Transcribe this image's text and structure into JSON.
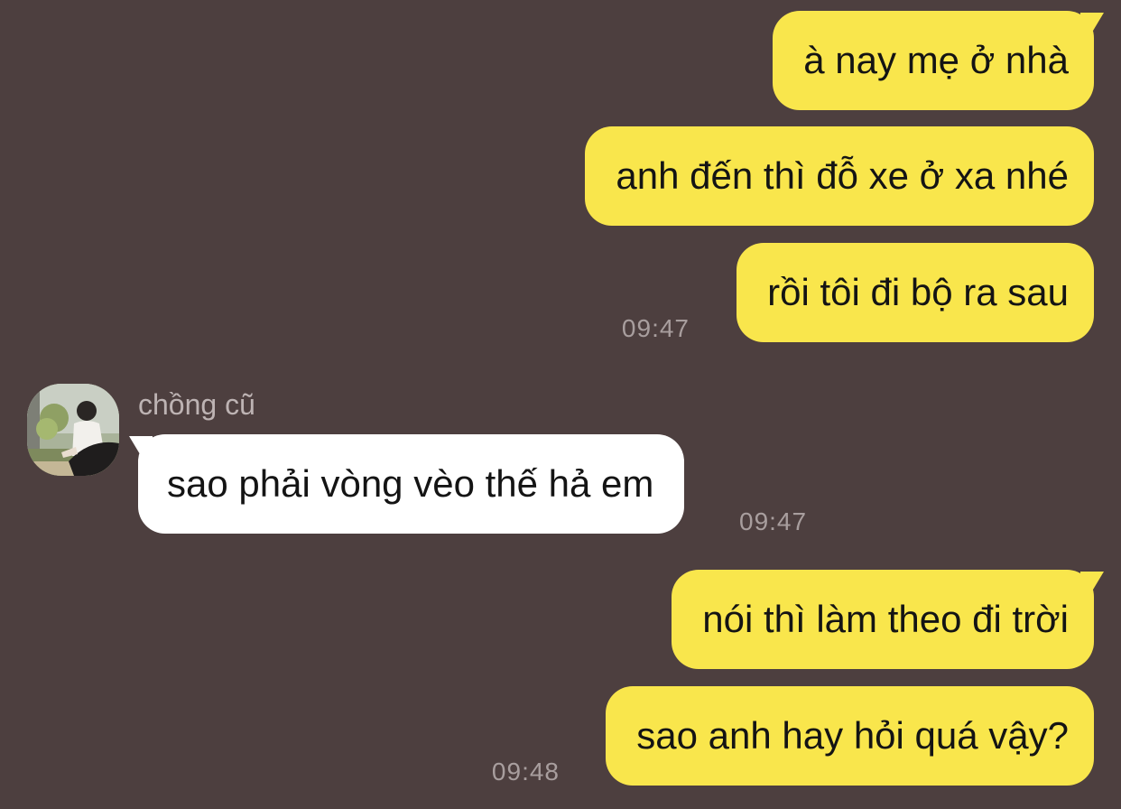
{
  "messages": [
    {
      "direction": "outgoing",
      "text": "à nay mẹ ở nhà"
    },
    {
      "direction": "outgoing",
      "text": "anh đến thì đỗ xe ở xa nhé"
    },
    {
      "direction": "outgoing",
      "text": "rồi tôi đi bộ ra sau",
      "time": "09:47"
    },
    {
      "direction": "incoming",
      "sender": "chồng cũ",
      "text": "sao phải vòng vèo thế hả em",
      "time": "09:47"
    },
    {
      "direction": "outgoing",
      "text": "nói thì làm theo đi trời"
    },
    {
      "direction": "outgoing",
      "text": "sao anh hay hỏi quá vậy?",
      "time": "09:48"
    }
  ],
  "colors": {
    "background": "#4d3f3f",
    "outgoing_bubble": "#f9e64c",
    "incoming_bubble": "#ffffff",
    "timestamp": "#a89e9e",
    "sender_name": "#bdb3b3"
  },
  "icons": {
    "avatar": "profile-photo"
  }
}
